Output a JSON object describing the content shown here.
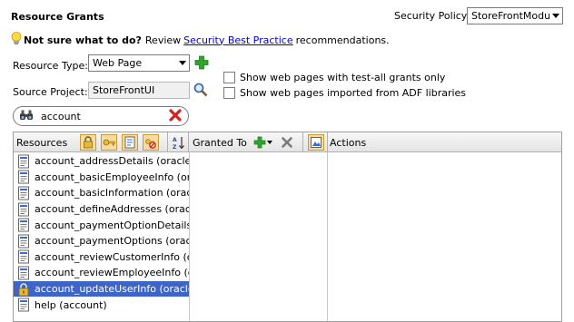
{
  "header": {
    "title": "Resource Grants",
    "security_policy_label": "Security Policy:",
    "security_policy_value": "StoreFrontModule"
  },
  "hint": {
    "bold": "Not sure what to do?",
    "pre": "Review",
    "link": "Security Best Practice",
    "post": "recommendations."
  },
  "form": {
    "resource_type_label": "Resource Type:",
    "resource_type_value": "Web Page",
    "source_project_label": "Source Project:",
    "source_project_value": "StoreFrontUI",
    "checkbox1": "Show web pages with test-all grants only",
    "checkbox2": "Show web pages imported from ADF libraries"
  },
  "search": {
    "value": "account"
  },
  "table": {
    "col_resources": "Resources",
    "col_granted_to": "Granted To",
    "col_actions": "Actions",
    "items": [
      "account_addressDetails (oracle.fodemo",
      "account_basicEmployeeInfo (oracle",
      "account_basicInformation (oracle.fo",
      "account_defineAddresses (oracle.fo",
      "account_paymentOptionDetails (ora",
      "account_paymentOptions (oracle.fo",
      "account_reviewCustomerInfo (oracl",
      "account_reviewEmployeeInfo (oracl",
      "account_updateUserInfo (oracle.fod",
      "help (account)"
    ],
    "selected_index": 8
  },
  "colors": {
    "selection": "#3d64c8",
    "link": "#0000cc",
    "add_green": "#2ea62e",
    "clear_red": "#d42020"
  }
}
